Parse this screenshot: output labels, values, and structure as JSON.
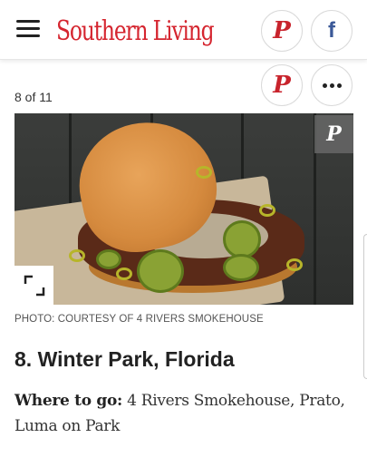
{
  "header": {
    "logo_text": "Southern Living",
    "brand_color": "#d5252f",
    "menu_icon": "hamburger-menu-icon",
    "share_icons": [
      "pinterest-icon",
      "facebook-icon"
    ],
    "pinterest_glyph": "P",
    "facebook_glyph": "f"
  },
  "slideshow": {
    "counter": "8 of 11",
    "share_buttons": [
      "pinterest-icon",
      "more-options-icon"
    ],
    "photo_overlay_pin_glyph": "P",
    "photo_credit": "PHOTO: COURTESY OF 4 RIVERS SMOKEHOUSE",
    "heading": "8. Winter Park, Florida",
    "body_lead": "Where to go:",
    "body_text": " 4 Rivers Smokehouse, Prato, Luma on Park"
  },
  "colors": {
    "pinterest": "#c8232c",
    "facebook": "#3b5998"
  }
}
